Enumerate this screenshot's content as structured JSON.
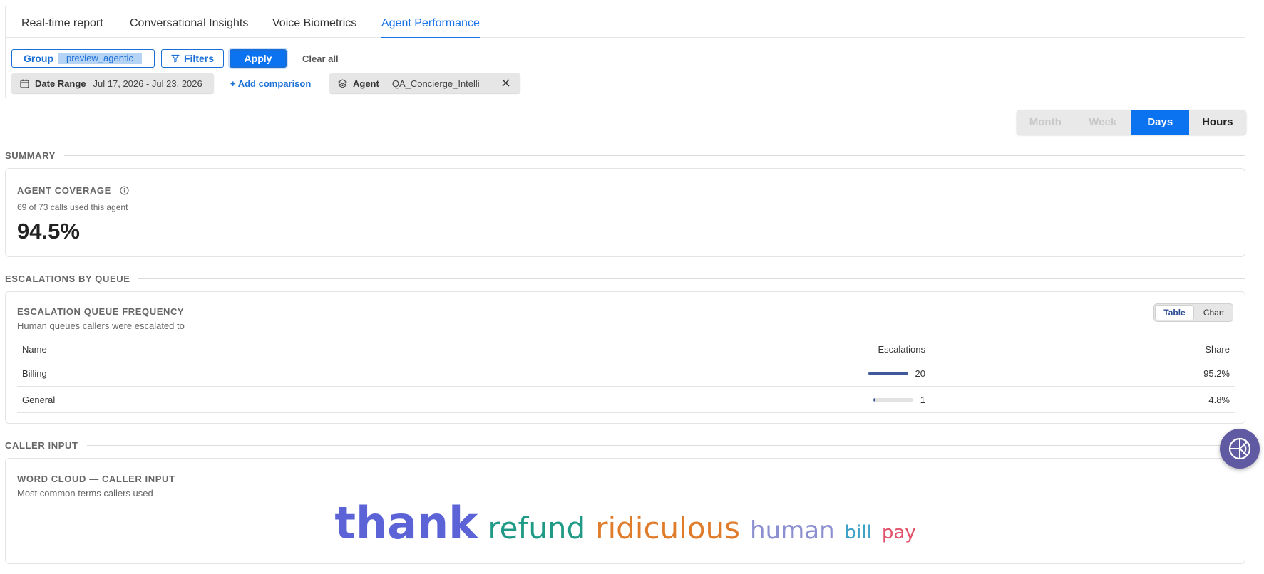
{
  "tabs": [
    {
      "label": "Real-time report"
    },
    {
      "label": "Conversational Insights"
    },
    {
      "label": "Voice Biometrics"
    },
    {
      "label": "Agent Performance",
      "active": true
    }
  ],
  "filters": {
    "group_label": "Group",
    "group_value": "preview_agentic",
    "filters_label": "Filters",
    "apply_label": "Apply",
    "clear_label": "Clear all",
    "date_label": "Date Range",
    "date_value": "Jul 17, 2026 - Jul 23, 2026",
    "add_comparison_label": "+ Add comparison",
    "agent_label": "Agent",
    "agent_value": "QA_Concierge_Intelli"
  },
  "granularity": {
    "options": [
      "Month",
      "Week",
      "Days",
      "Hours"
    ],
    "selected": "Days"
  },
  "summary": {
    "section_title": "SUMMARY",
    "card_title": "AGENT COVERAGE",
    "subtitle": "69 of 73 calls used this agent",
    "value": "94.5%"
  },
  "escalations": {
    "section_title": "ESCALATIONS BY QUEUE",
    "card_title": "ESCALATION QUEUE FREQUENCY",
    "subtitle": "Human queues callers were escalated to",
    "view_options": [
      "Table",
      "Chart"
    ],
    "selected_view": "Table",
    "columns": [
      "Name",
      "Escalations",
      "Share"
    ],
    "rows": [
      {
        "name": "Billing",
        "escalations": "20",
        "share": "95.2%",
        "bar_fraction": 1.0
      },
      {
        "name": "General",
        "escalations": "1",
        "share": "4.8%",
        "bar_fraction": 0.05
      }
    ]
  },
  "caller_input": {
    "section_title": "CALLER INPUT",
    "card_title": "WORD CLOUD — CALLER INPUT",
    "subtitle": "Most common terms callers used",
    "words": [
      {
        "text": "thank",
        "color": "#5b63d6"
      },
      {
        "text": "refund",
        "color": "#1f9a86"
      },
      {
        "text": "ridiculous",
        "color": "#e07b2a"
      },
      {
        "text": "human",
        "color": "#8b8fd0"
      },
      {
        "text": "bill",
        "color": "#3fa1c8"
      },
      {
        "text": "pay",
        "color": "#e0536a"
      }
    ]
  },
  "colors": {
    "accent": "#0b72f0",
    "link": "#1a6fd6",
    "fab": "#5f5aa2"
  }
}
